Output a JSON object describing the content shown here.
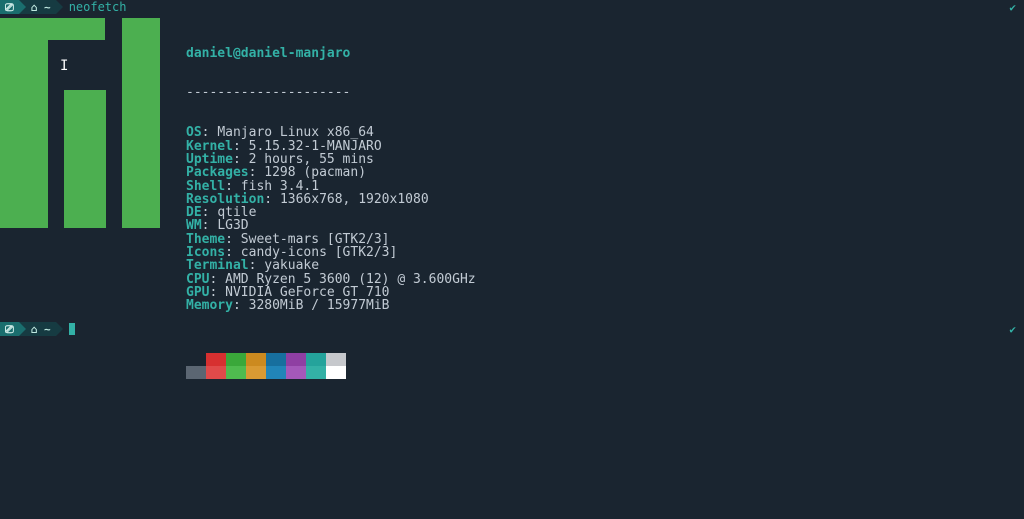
{
  "prompt1": {
    "icon_glyph": "⎚",
    "home_glyph": "⌂",
    "home_text": " ~",
    "command": "neofetch",
    "check": "✔"
  },
  "prompt2": {
    "icon_glyph": "⎚",
    "home_glyph": "⌂",
    "home_text": " ~",
    "check": "✔"
  },
  "neofetch": {
    "title": "daniel@daniel-manjaro",
    "dashes": "---------------------",
    "lines": [
      {
        "label": "OS",
        "value": "Manjaro Linux x86_64"
      },
      {
        "label": "Kernel",
        "value": "5.15.32-1-MANJARO"
      },
      {
        "label": "Uptime",
        "value": "2 hours, 55 mins"
      },
      {
        "label": "Packages",
        "value": "1298 (pacman)"
      },
      {
        "label": "Shell",
        "value": "fish 3.4.1"
      },
      {
        "label": "Resolution",
        "value": "1366x768, 1920x1080"
      },
      {
        "label": "DE",
        "value": "qtile"
      },
      {
        "label": "WM",
        "value": "LG3D"
      },
      {
        "label": "Theme",
        "value": "Sweet-mars [GTK2/3]"
      },
      {
        "label": "Icons",
        "value": "candy-icons [GTK2/3]"
      },
      {
        "label": "Terminal",
        "value": "yakuake"
      },
      {
        "label": "CPU",
        "value": "AMD Ryzen 5 3600 (12) @ 3.600GHz"
      },
      {
        "label": "GPU",
        "value": "NVIDIA GeForce GT 710"
      },
      {
        "label": "Memory",
        "value": "3280MiB / 15977MiB"
      }
    ],
    "swatches_top": [
      "#1a2530",
      "#d73030",
      "#3aa83a",
      "#cc8a1f",
      "#176f9e",
      "#8f3fa3",
      "#24a39b",
      "#c6c8cc"
    ],
    "swatches_bottom": [
      "#5b6672",
      "#e04a4a",
      "#4fbb4f",
      "#d99a33",
      "#2185b8",
      "#a458ba",
      "#33b1a6",
      "#ffffff"
    ]
  }
}
